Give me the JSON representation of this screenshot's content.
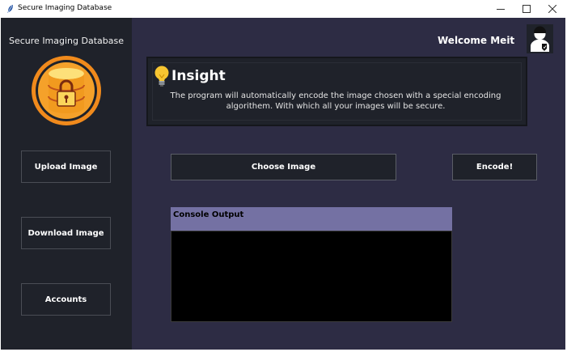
{
  "window": {
    "title": "Secure Imaging Database",
    "app_icon": "feather-icon",
    "controls": [
      "minimize-icon",
      "maximize-icon",
      "close-icon"
    ]
  },
  "sidebar": {
    "title": "Secure Imaging Database",
    "logo_icon": "database-lock-icon",
    "buttons": [
      {
        "label": "Upload Image"
      },
      {
        "label": "Download Image"
      },
      {
        "label": "Accounts"
      }
    ]
  },
  "header": {
    "welcome": "Welcome Meit",
    "avatar_icon": "user-shield-icon"
  },
  "insight": {
    "icon": "lightbulb-icon",
    "title": "Insight",
    "text": "The program will automatically encode the image chosen with a special encoding algorithem. With which all your images will be secure."
  },
  "actions": {
    "choose_label": "Choose Image",
    "encode_label": "Encode!"
  },
  "console": {
    "header": "Console Output",
    "output": ""
  },
  "colors": {
    "main_bg": "#2d2c44",
    "sidebar_bg": "#1f222a",
    "console_header": "#7471a3",
    "console_bg": "#000000",
    "logo_orange": "#f08a1c"
  }
}
